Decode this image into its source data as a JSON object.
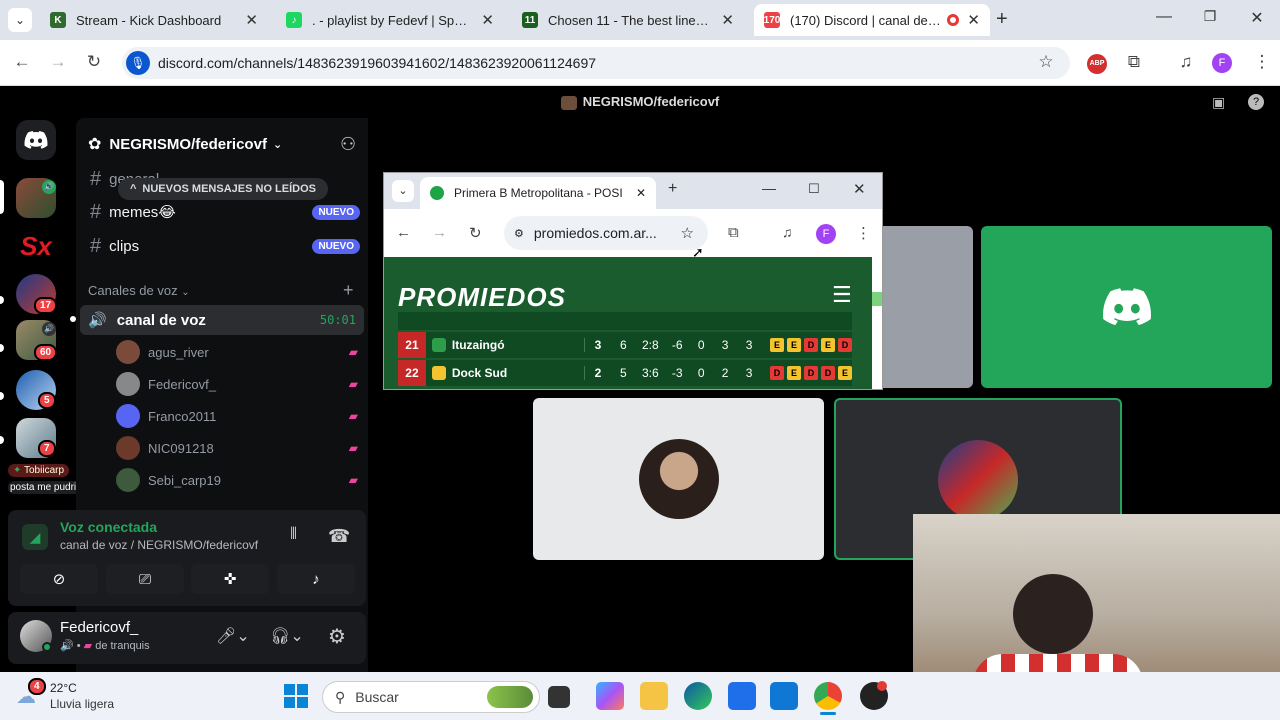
{
  "tabs": [
    {
      "title": "Stream - Kick Dashboard",
      "favicon": "kick-icon",
      "color": "#2f6b2f",
      "glyph": "K"
    },
    {
      "title": ". - playlist by Fedevf | Spotify",
      "favicon": "spotify-icon",
      "color": "#1ed760",
      "glyph": "♪"
    },
    {
      "title": "Chosen 11 - The best lineup bu",
      "favicon": "chosen11-icon",
      "color": "#1b5e20",
      "glyph": "11"
    },
    {
      "title": "(170) Discord | canal de voz",
      "favicon": "discord-icon",
      "color": "#ed4245",
      "glyph": "170"
    }
  ],
  "url": "discord.com/channels/1483623919603941602/1483623920061124697",
  "profile_initial": "F",
  "discord": {
    "title": "NEGRISMO/federicovf",
    "server_name": "NEGRISMO/federicovf",
    "new_messages_pill": "NUEVOS MENSAJES NO LEÍDOS",
    "text_channels": [
      {
        "name": "general",
        "badge": ""
      },
      {
        "name": "memes😂",
        "badge": "NUEVO"
      },
      {
        "name": "clips",
        "badge": "NUEVO"
      }
    ],
    "voice_category": "Canales de voz",
    "voice_channel": "canal de voz",
    "voice_timer": "50:01",
    "voice_users": [
      "agus_river",
      "Federicovf_",
      "Franco2011",
      "NIC091218",
      "Sebi_carp19"
    ],
    "server_badges": [
      "17",
      "60",
      "5",
      "7"
    ],
    "tooltip_user": "Tobiicarp",
    "tooltip_text": "posta me pudri",
    "voice_connected": "Voz conectada",
    "voice_connected_sub": "canal de voz / NEGRISMO/federicovf",
    "user_name": "Federicovf_",
    "user_status": "de tranquis"
  },
  "popup": {
    "tab_title": "Primera B Metropolitana - POSI",
    "url": "promiedos.com.ar...",
    "logo": "PROMIEDOS",
    "rows": [
      {
        "pos": "21",
        "team": "Ituzaingó",
        "pts": "3",
        "pj": "6",
        "goals": "2:8",
        "dif": "-6",
        "w": "0",
        "d": "3",
        "l": "3",
        "form": [
          "E",
          "E",
          "D",
          "E",
          "D"
        ]
      },
      {
        "pos": "22",
        "team": "Dock Sud",
        "pts": "2",
        "pj": "5",
        "goals": "3:6",
        "dif": "-3",
        "w": "0",
        "d": "2",
        "l": "3",
        "form": [
          "D",
          "E",
          "D",
          "D",
          "E"
        ]
      }
    ]
  },
  "taskbar": {
    "weather_temp": "22°C",
    "weather_desc": "Lluvia ligera",
    "weather_badge": "4",
    "search_placeholder": "Buscar"
  }
}
